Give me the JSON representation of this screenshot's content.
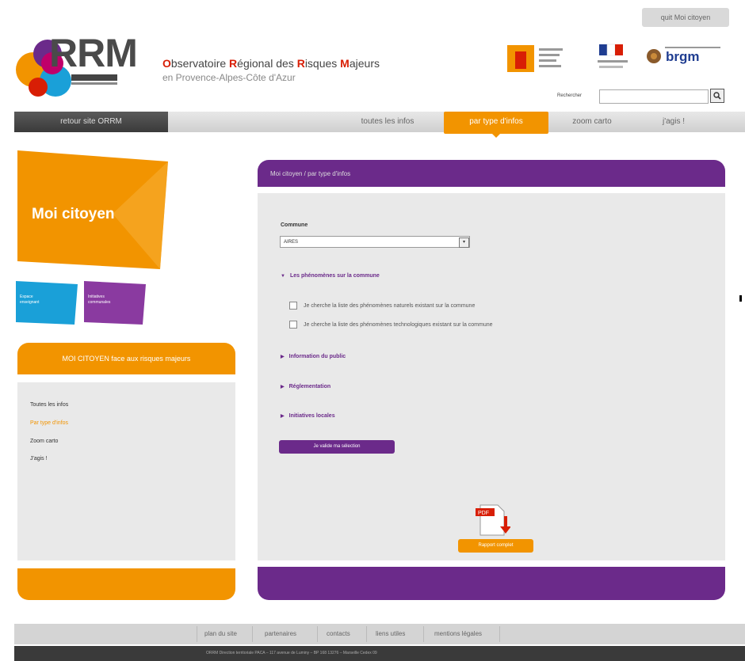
{
  "header": {
    "quit_label": "quit Moi citoyen",
    "logo_word": "RRM",
    "title_parts": [
      {
        "text": "O",
        "hl": true
      },
      {
        "text": "bservatoire ",
        "hl": false
      },
      {
        "text": "R",
        "hl": true
      },
      {
        "text": "égional des ",
        "hl": false
      },
      {
        "text": "R",
        "hl": true
      },
      {
        "text": "isques ",
        "hl": false
      },
      {
        "text": "M",
        "hl": true
      },
      {
        "text": "ajeurs",
        "hl": false
      }
    ],
    "subtitle": "en Provence-Alpes-Côte d'Azur",
    "search_label": "Rechercher",
    "search_value": "",
    "partner_brgm": "brgm"
  },
  "nav": {
    "back_label": "retour site ORRM",
    "items": [
      {
        "label": "toutes les infos",
        "active": false
      },
      {
        "label": "par type d'infos",
        "active": true
      },
      {
        "label": "zoom carto",
        "active": false
      },
      {
        "label": "j'agis !",
        "active": false
      }
    ]
  },
  "left": {
    "card_title": "Moi citoyen",
    "blue_card_text": "Espace\nenseignant",
    "purple_card_text": "Initiatives\ncommunales",
    "section_title": "MOI CITOYEN face aux risques majeurs",
    "links": [
      {
        "label": "Toutes les infos",
        "active": false
      },
      {
        "label": "Par type d'infos",
        "active": true
      },
      {
        "label": "Zoom carto",
        "active": false
      },
      {
        "label": "J'agis !",
        "active": false
      }
    ]
  },
  "main": {
    "breadcrumb": "Moi citoyen / par type d'infos",
    "commune_label": "Commune",
    "commune_value": "AIRES",
    "sections": {
      "phenomenes": "Les phénomènes sur la commune",
      "information": "Information du public",
      "reglementation": "Réglementation",
      "initiatives": "Initiatives locales"
    },
    "checkboxes": [
      {
        "label": "Je cherche la liste des phénomènes naturels existant sur la commune",
        "checked": false
      },
      {
        "label": "Je cherche la liste des phénomènes technologiques existant sur la commune",
        "checked": false
      }
    ],
    "validate_label": "Je valide ma sélection",
    "pdf_badge": "PDF",
    "report_label": "Rapport complet"
  },
  "footer": {
    "links": [
      "plan du site",
      "partenaires",
      "contacts",
      "liens utiles",
      "mentions légales"
    ],
    "address": "ORRM Direction territoriale PACA – 117 avenue de Luminy – BP 168 13276 – Marseille Cedex 09"
  },
  "colors": {
    "orange": "#f29400",
    "purple": "#6b2a8a",
    "red": "#d81e05"
  }
}
